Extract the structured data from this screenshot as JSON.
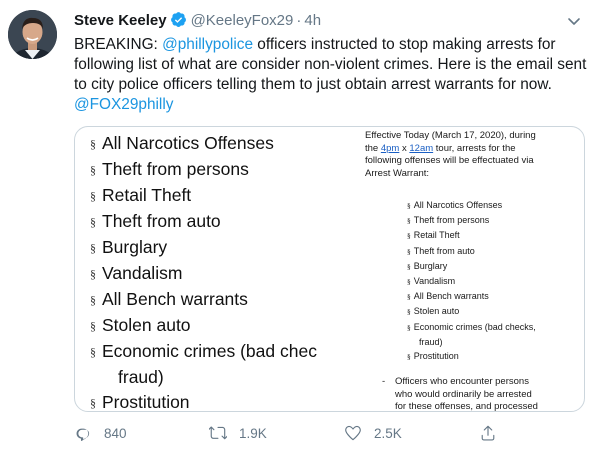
{
  "author": {
    "name": "Steve Keeley",
    "handle": "@KeeleyFox29",
    "separator": "·",
    "time": "4h"
  },
  "tweet": {
    "prefix": "BREAKING:  ",
    "mention1": "@phillypolice",
    "body": " officers instructed to stop making arrests for following list of what are consider non-violent crimes.    Here is the email sent to city police officers telling them to just obtain arrest warrants for now. ",
    "mention2": "@FOX29philly"
  },
  "media": {
    "section_symbol": "§",
    "big_list": [
      "All Narcotics Offenses",
      "Theft from persons",
      "Retail Theft",
      "Theft from auto",
      "Burglary",
      "Vandalism",
      "All Bench warrants",
      "Stolen auto",
      "Economic crimes (bad chec"
    ],
    "big_list_cont": "fraud)",
    "big_list_last": "Prostitution",
    "memo_line1": "Effective Today (March 17, 2020), during",
    "memo_the": "the ",
    "memo_4pm": "4pm",
    "memo_x": " x ",
    "memo_12am": "12am",
    "memo_line2_rest": " tour, arrests for the",
    "memo_line3": "following offenses will be effectuated via",
    "memo_line4": "Arrest Warrant:",
    "small_list": [
      "All Narcotics Offenses",
      "Theft from persons",
      "Retail Theft",
      "Theft from auto",
      "Burglary",
      "Vandalism",
      "All Bench warrants",
      "Stolen auto",
      "Economic crimes (bad checks,"
    ],
    "small_list_cont": "fraud)",
    "small_list_last": "Prostitution",
    "memo_bullet": "-",
    "memo_foot1": "Officers who encounter persons",
    "memo_foot2": "who would ordinarily be arrested",
    "memo_foot3": "for these offenses, and processed"
  },
  "actions": {
    "reply_count": "840",
    "retweet_count": "1.9K",
    "like_count": "2.5K"
  },
  "icons": {
    "verified": "verified-badge-icon",
    "caret": "chevron-down-icon",
    "reply": "reply-icon",
    "retweet": "retweet-icon",
    "like": "heart-icon",
    "share": "share-icon"
  },
  "colors": {
    "link": "#1b95e0",
    "verified": "#1da1f2",
    "muted": "#657786"
  }
}
